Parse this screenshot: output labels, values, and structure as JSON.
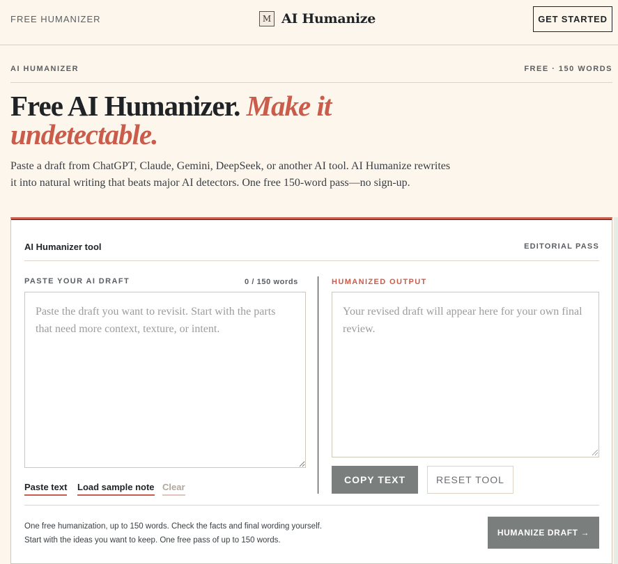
{
  "nav": {
    "left_link": "FREE HUMANIZER",
    "brand_logo": "M",
    "brand_name": "AI Humanize",
    "cta": "GET STARTED"
  },
  "section": {
    "label": "AI HUMANIZER",
    "meta": "FREE · 150 WORDS"
  },
  "hero": {
    "title_plain": "Free AI Humanizer.",
    "title_accent": "Make it undetectable.",
    "subtitle": "Paste a draft from ChatGPT, Claude, Gemini, DeepSeek, or another AI tool. AI Humanize rewrites it into natural writing that beats major AI detectors. One free 150-word pass—no sign-up."
  },
  "tool": {
    "title": "AI Humanizer tool",
    "badge": "EDITORIAL PASS",
    "input_label": "PASTE YOUR AI DRAFT",
    "word_count": "0 / 150 words",
    "input_placeholder": "Paste the draft you want to revisit. Start with the parts that need more context, texture, or intent.",
    "output_label": "HUMANIZED OUTPUT",
    "output_placeholder": "Your revised draft will appear here for your own final review.",
    "actions": {
      "paste": "Paste text",
      "sample": "Load sample note",
      "clear": "Clear"
    },
    "copy_button": "COPY TEXT",
    "reset_button": "RESET TOOL",
    "foot_line1": "One free humanization, up to 150 words. Check the facts and final wording yourself.",
    "foot_line2": "Start with the ideas you want to keep. One free pass of up to 150 words.",
    "humanize_button": "HUMANIZE DRAFT →"
  },
  "colors": {
    "background": "#fdf6ec",
    "accent": "#c95c4a",
    "button_gray": "#7a7e7c",
    "text": "#1f2326"
  }
}
